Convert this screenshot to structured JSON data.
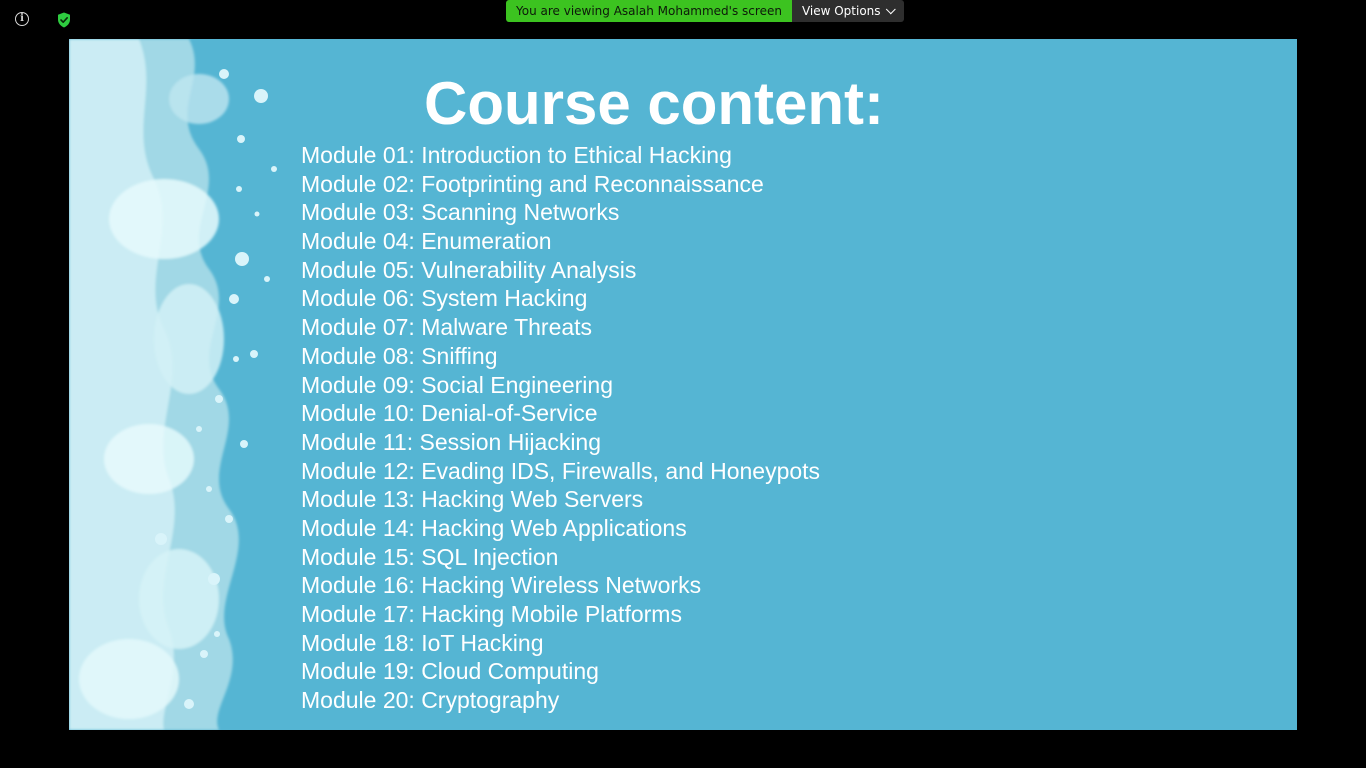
{
  "toolbar": {
    "info_icon": "info-icon",
    "info_glyph": "i",
    "security_icon": "shield-check-icon",
    "security_color": "#2ecc40"
  },
  "share_banner": {
    "viewing_text": "You are viewing Asalah Mohammed's screen",
    "view_options_label": "View Options",
    "viewing_color": "#3cc320"
  },
  "slide": {
    "background_color": "#55b5d3",
    "title": "Course content:",
    "modules": [
      "Module 01: Introduction to Ethical Hacking",
      "Module 02: Footprinting and Reconnaissance",
      "Module 03: Scanning Networks",
      "Module 04: Enumeration",
      "Module 05: Vulnerability Analysis",
      "Module 06: System Hacking",
      "Module 07: Malware Threats",
      "Module 08: Sniffing",
      "Module 09: Social Engineering",
      "Module 10: Denial-of-Service",
      "Module 11: Session Hijacking",
      "Module 12: Evading IDS, Firewalls, and Honeypots",
      "Module 13: Hacking Web Servers",
      "Module 14: Hacking Web Applications",
      "Module 15: SQL Injection",
      "Module 16: Hacking Wireless Networks",
      "Module 17: Hacking Mobile Platforms",
      "Module 18: IoT Hacking",
      "Module 19: Cloud Computing",
      "Module 20: Cryptography"
    ]
  }
}
